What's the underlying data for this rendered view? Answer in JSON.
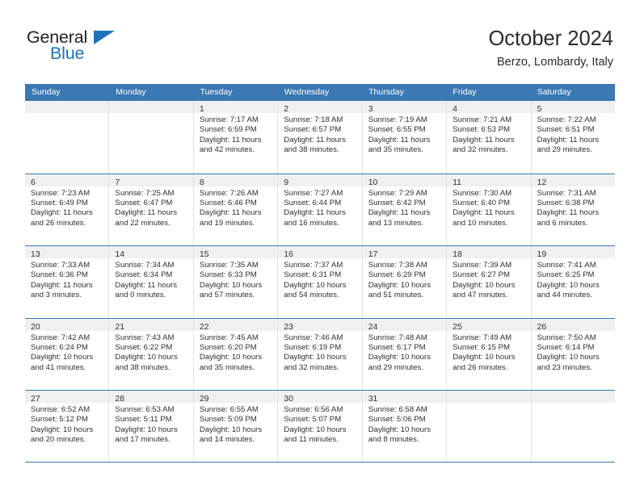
{
  "brand": {
    "name_part1": "General",
    "name_part2": "Blue",
    "triangle_icon": "triangle-logo-icon",
    "colors": {
      "dark": "#231f20",
      "blue": "#1d72b8"
    }
  },
  "header": {
    "title": "October 2024",
    "location": "Berzo, Lombardy, Italy"
  },
  "calendar": {
    "accent_color": "#3c78b4",
    "band_color": "#f0f0f0",
    "weekdays": [
      "Sunday",
      "Monday",
      "Tuesday",
      "Wednesday",
      "Thursday",
      "Friday",
      "Saturday"
    ],
    "weeks": [
      [
        {
          "day": "",
          "lines": []
        },
        {
          "day": "",
          "lines": []
        },
        {
          "day": "1",
          "lines": [
            "Sunrise: 7:17 AM",
            "Sunset: 6:59 PM",
            "Daylight: 11 hours",
            "and 42 minutes."
          ]
        },
        {
          "day": "2",
          "lines": [
            "Sunrise: 7:18 AM",
            "Sunset: 6:57 PM",
            "Daylight: 11 hours",
            "and 38 minutes."
          ]
        },
        {
          "day": "3",
          "lines": [
            "Sunrise: 7:19 AM",
            "Sunset: 6:55 PM",
            "Daylight: 11 hours",
            "and 35 minutes."
          ]
        },
        {
          "day": "4",
          "lines": [
            "Sunrise: 7:21 AM",
            "Sunset: 6:53 PM",
            "Daylight: 11 hours",
            "and 32 minutes."
          ]
        },
        {
          "day": "5",
          "lines": [
            "Sunrise: 7:22 AM",
            "Sunset: 6:51 PM",
            "Daylight: 11 hours",
            "and 29 minutes."
          ]
        }
      ],
      [
        {
          "day": "6",
          "lines": [
            "Sunrise: 7:23 AM",
            "Sunset: 6:49 PM",
            "Daylight: 11 hours",
            "and 26 minutes."
          ]
        },
        {
          "day": "7",
          "lines": [
            "Sunrise: 7:25 AM",
            "Sunset: 6:47 PM",
            "Daylight: 11 hours",
            "and 22 minutes."
          ]
        },
        {
          "day": "8",
          "lines": [
            "Sunrise: 7:26 AM",
            "Sunset: 6:46 PM",
            "Daylight: 11 hours",
            "and 19 minutes."
          ]
        },
        {
          "day": "9",
          "lines": [
            "Sunrise: 7:27 AM",
            "Sunset: 6:44 PM",
            "Daylight: 11 hours",
            "and 16 minutes."
          ]
        },
        {
          "day": "10",
          "lines": [
            "Sunrise: 7:29 AM",
            "Sunset: 6:42 PM",
            "Daylight: 11 hours",
            "and 13 minutes."
          ]
        },
        {
          "day": "11",
          "lines": [
            "Sunrise: 7:30 AM",
            "Sunset: 6:40 PM",
            "Daylight: 11 hours",
            "and 10 minutes."
          ]
        },
        {
          "day": "12",
          "lines": [
            "Sunrise: 7:31 AM",
            "Sunset: 6:38 PM",
            "Daylight: 11 hours",
            "and 6 minutes."
          ]
        }
      ],
      [
        {
          "day": "13",
          "lines": [
            "Sunrise: 7:33 AM",
            "Sunset: 6:36 PM",
            "Daylight: 11 hours",
            "and 3 minutes."
          ]
        },
        {
          "day": "14",
          "lines": [
            "Sunrise: 7:34 AM",
            "Sunset: 6:34 PM",
            "Daylight: 11 hours",
            "and 0 minutes."
          ]
        },
        {
          "day": "15",
          "lines": [
            "Sunrise: 7:35 AM",
            "Sunset: 6:33 PM",
            "Daylight: 10 hours",
            "and 57 minutes."
          ]
        },
        {
          "day": "16",
          "lines": [
            "Sunrise: 7:37 AM",
            "Sunset: 6:31 PM",
            "Daylight: 10 hours",
            "and 54 minutes."
          ]
        },
        {
          "day": "17",
          "lines": [
            "Sunrise: 7:38 AM",
            "Sunset: 6:29 PM",
            "Daylight: 10 hours",
            "and 51 minutes."
          ]
        },
        {
          "day": "18",
          "lines": [
            "Sunrise: 7:39 AM",
            "Sunset: 6:27 PM",
            "Daylight: 10 hours",
            "and 47 minutes."
          ]
        },
        {
          "day": "19",
          "lines": [
            "Sunrise: 7:41 AM",
            "Sunset: 6:25 PM",
            "Daylight: 10 hours",
            "and 44 minutes."
          ]
        }
      ],
      [
        {
          "day": "20",
          "lines": [
            "Sunrise: 7:42 AM",
            "Sunset: 6:24 PM",
            "Daylight: 10 hours",
            "and 41 minutes."
          ]
        },
        {
          "day": "21",
          "lines": [
            "Sunrise: 7:43 AM",
            "Sunset: 6:22 PM",
            "Daylight: 10 hours",
            "and 38 minutes."
          ]
        },
        {
          "day": "22",
          "lines": [
            "Sunrise: 7:45 AM",
            "Sunset: 6:20 PM",
            "Daylight: 10 hours",
            "and 35 minutes."
          ]
        },
        {
          "day": "23",
          "lines": [
            "Sunrise: 7:46 AM",
            "Sunset: 6:19 PM",
            "Daylight: 10 hours",
            "and 32 minutes."
          ]
        },
        {
          "day": "24",
          "lines": [
            "Sunrise: 7:48 AM",
            "Sunset: 6:17 PM",
            "Daylight: 10 hours",
            "and 29 minutes."
          ]
        },
        {
          "day": "25",
          "lines": [
            "Sunrise: 7:49 AM",
            "Sunset: 6:15 PM",
            "Daylight: 10 hours",
            "and 26 minutes."
          ]
        },
        {
          "day": "26",
          "lines": [
            "Sunrise: 7:50 AM",
            "Sunset: 6:14 PM",
            "Daylight: 10 hours",
            "and 23 minutes."
          ]
        }
      ],
      [
        {
          "day": "27",
          "lines": [
            "Sunrise: 6:52 AM",
            "Sunset: 5:12 PM",
            "Daylight: 10 hours",
            "and 20 minutes."
          ]
        },
        {
          "day": "28",
          "lines": [
            "Sunrise: 6:53 AM",
            "Sunset: 5:11 PM",
            "Daylight: 10 hours",
            "and 17 minutes."
          ]
        },
        {
          "day": "29",
          "lines": [
            "Sunrise: 6:55 AM",
            "Sunset: 5:09 PM",
            "Daylight: 10 hours",
            "and 14 minutes."
          ]
        },
        {
          "day": "30",
          "lines": [
            "Sunrise: 6:56 AM",
            "Sunset: 5:07 PM",
            "Daylight: 10 hours",
            "and 11 minutes."
          ]
        },
        {
          "day": "31",
          "lines": [
            "Sunrise: 6:58 AM",
            "Sunset: 5:06 PM",
            "Daylight: 10 hours",
            "and 8 minutes."
          ]
        },
        {
          "day": "",
          "lines": []
        },
        {
          "day": "",
          "lines": []
        }
      ]
    ]
  }
}
